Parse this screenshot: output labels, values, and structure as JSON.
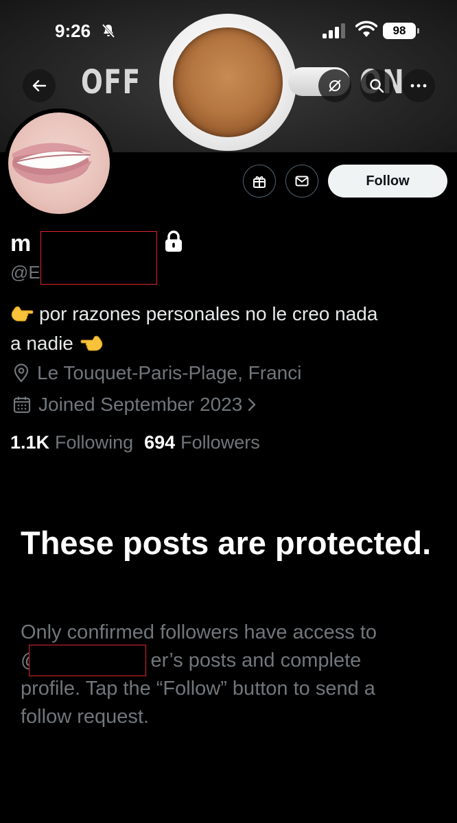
{
  "status_bar": {
    "time": "9:26",
    "battery": "98"
  },
  "banner": {
    "left_word": "OFF",
    "right_word": "ON"
  },
  "actions": {
    "follow_label": "Follow"
  },
  "profile": {
    "display_name_visible": "m",
    "handle_visible": "@E",
    "bio_line1": "por razones personales no le creo nada",
    "bio_line2": "a nadie",
    "location": "Le Touquet-Paris-Plage, Franci",
    "joined": "Joined September 2023",
    "following_count": "1.1K",
    "following_label": "Following",
    "followers_count": "694",
    "followers_label": "Followers"
  },
  "protected": {
    "title": "These posts are protected.",
    "body_line1": "Only confirmed followers have access to",
    "body_line2_prefix": "@",
    "body_line2_suffix": "er’s posts and complete",
    "body_line3": "profile. Tap the “Follow” button to send a",
    "body_line4": "follow request."
  },
  "colors": {
    "background": "#000000",
    "secondary_text": "#71767b",
    "follow_bg": "#eff3f4",
    "redaction": "#e0252b"
  },
  "icons": [
    "bell-slash-icon",
    "signal-icon",
    "wifi-icon",
    "back-arrow-icon",
    "translate-icon",
    "search-icon",
    "more-icon",
    "gift-icon",
    "mail-icon",
    "lock-icon",
    "location-icon",
    "calendar-icon",
    "chevron-right-icon",
    "pointing-hand-emoji"
  ]
}
